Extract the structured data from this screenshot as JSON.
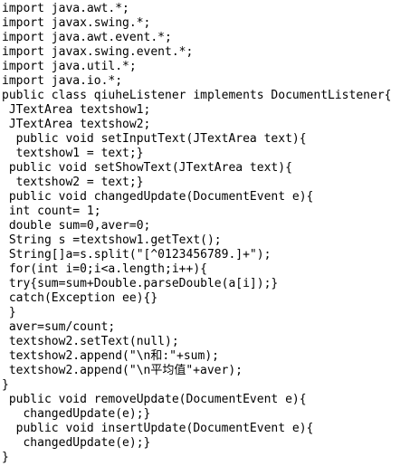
{
  "document": {
    "lines": [
      "import java.awt.*;",
      "import javax.swing.*;",
      "import java.awt.event.*;",
      "import javax.swing.event.*;",
      "import java.util.*;",
      "import java.io.*;",
      "public class qiuheListener implements DocumentListener{",
      " JTextArea textshow1;",
      " JTextArea textshow2;",
      "  public void setInputText(JTextArea text){",
      "  textshow1 = text;}",
      " public void setShowText(JTextArea text){",
      "  textshow2 = text;}",
      " public void changedUpdate(DocumentEvent e){",
      " int count= 1;",
      " double sum=0,aver=0;",
      " String s =textshow1.getText();",
      " String[]a=s.split(\"[^0123456789.]+\");",
      " for(int i=0;i<a.length;i++){",
      " try{sum=sum+Double.parseDouble(a[i]);}",
      " catch(Exception ee){}",
      " }",
      " aver=sum/count;",
      " textshow2.setText(null);",
      " textshow2.append(\"\\n和:\"+sum);",
      " textshow2.append(\"\\n平均值\"+aver);",
      "}",
      " public void removeUpdate(DocumentEvent e){",
      "   changedUpdate(e);}",
      "  public void insertUpdate(DocumentEvent e){",
      "   changedUpdate(e);}",
      "}"
    ]
  }
}
